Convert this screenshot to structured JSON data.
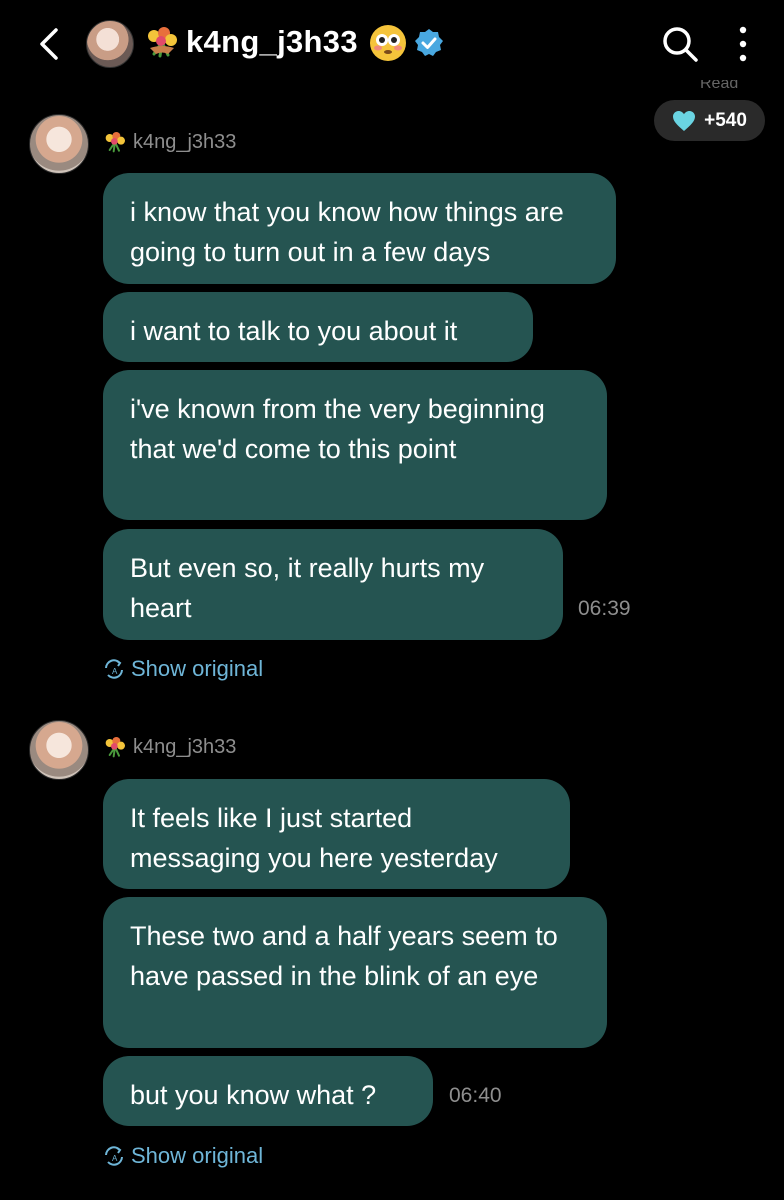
{
  "header": {
    "username": "k4ng_j3h33",
    "flower_emoji": "💐",
    "flushed_emoji": "😳",
    "icons": [
      "back-chevron-icon",
      "search-icon",
      "more-vertical-icon",
      "verified-badge-icon"
    ],
    "cut_label": "Read",
    "pill_text": "+540",
    "accent_color": "#255451"
  },
  "groups": [
    {
      "sender": "k4ng_j3h33",
      "sender_emoji": "💐",
      "messages": [
        "i know that you know how things are going to turn out in a few days",
        "i want to talk to you about it",
        "i've known from the very beginning that we'd come to this point",
        "But even so, it really hurts my heart"
      ],
      "time": "06:39",
      "show_original": "Show original"
    },
    {
      "sender": "k4ng_j3h33",
      "sender_emoji": "💐",
      "messages": [
        "It feels like I just started messaging you here yesterday",
        "These two and a half years seem to have passed in the blink of an eye",
        "but you know what ?"
      ],
      "time": "06:40",
      "show_original": "Show original"
    }
  ]
}
